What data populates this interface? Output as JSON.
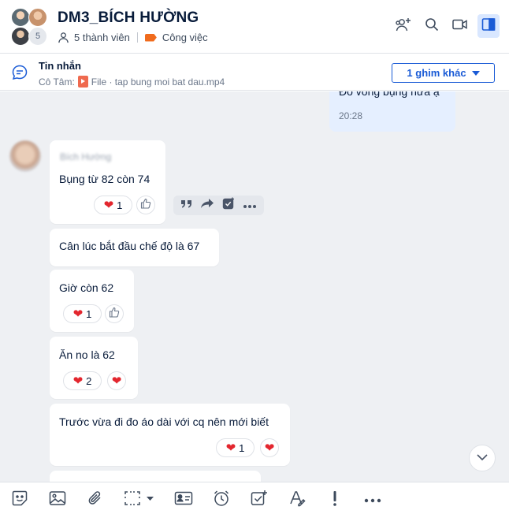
{
  "header": {
    "title": "DM3_BÍCH HƯỜNG",
    "member_count_badge": "5",
    "members_label": "5 thành viên",
    "tag_label": "Công việc",
    "tag_color": "#f06b1d",
    "icons": [
      "add-member-icon",
      "search-icon",
      "video-call-icon",
      "sidebar-toggle-icon"
    ]
  },
  "pinned": {
    "title": "Tin nhắn",
    "sender": "Cô Tâm:",
    "file_text": "File · tap bung moi bat dau.mp4",
    "button_label": "1 ghim khác"
  },
  "messages": {
    "own": {
      "text": "Đo vòng bụng nữa ạ",
      "time": "20:28"
    },
    "sender_name": "Bích Hường",
    "items": [
      {
        "text": "Bụng từ 82 còn 74",
        "reaction_count": "1"
      },
      {
        "text": "Cân lúc bắt đầu chế độ là 67"
      },
      {
        "text": "Giờ còn 62",
        "reaction_count": "1"
      },
      {
        "text": "Ăn no là 62",
        "reaction_count": "2"
      },
      {
        "text": "Trước vừa đi đo áo dài với cq nên mới biết",
        "reaction_count": "1"
      }
    ]
  },
  "hover_tools": [
    "quote-icon",
    "forward-icon",
    "task-icon",
    "more-icon"
  ],
  "toolbar": [
    "sticker-icon",
    "image-icon",
    "attach-icon",
    "screenshot-icon",
    "contact-card-icon",
    "reminder-icon",
    "task-icon",
    "format-text-icon",
    "urgent-icon",
    "more-icon"
  ],
  "colors": {
    "accent": "#1a5bd6",
    "chat_bg": "#eef0f3",
    "own_bubble": "#e5efff",
    "heart": "#e3262e"
  }
}
